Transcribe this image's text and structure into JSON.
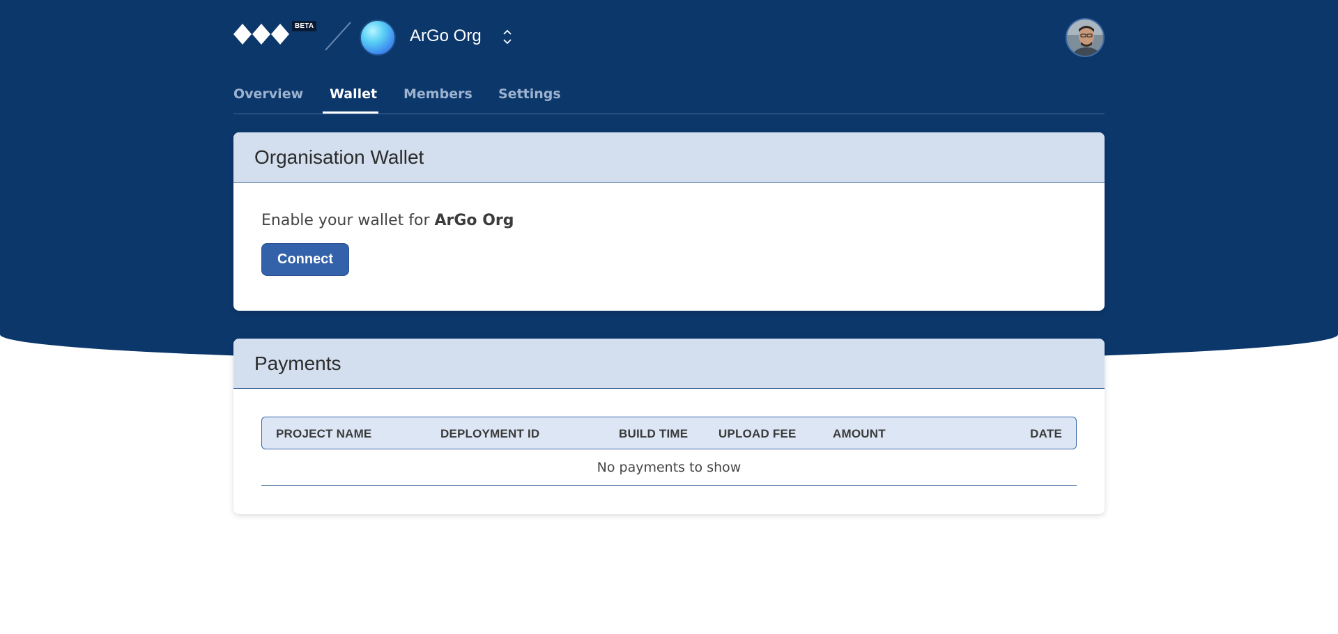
{
  "header": {
    "beta_badge": "BETA",
    "org_name": "ArGo Org"
  },
  "tabs": [
    {
      "label": "Overview",
      "active": false
    },
    {
      "label": "Wallet",
      "active": true
    },
    {
      "label": "Members",
      "active": false
    },
    {
      "label": "Settings",
      "active": false
    }
  ],
  "wallet": {
    "title": "Organisation Wallet",
    "prompt": "Enable your wallet for ",
    "org_name": "ArGo Org",
    "connect_label": "Connect"
  },
  "payments": {
    "title": "Payments",
    "columns": [
      "PROJECT NAME",
      "DEPLOYMENT ID",
      "BUILD TIME",
      "UPLOAD FEE",
      "AMOUNT",
      "DATE"
    ],
    "empty_message": "No payments to show"
  },
  "colors": {
    "hero_background": "#0b376b",
    "card_header": "#d3deee",
    "primary_button": "#3361aa"
  }
}
